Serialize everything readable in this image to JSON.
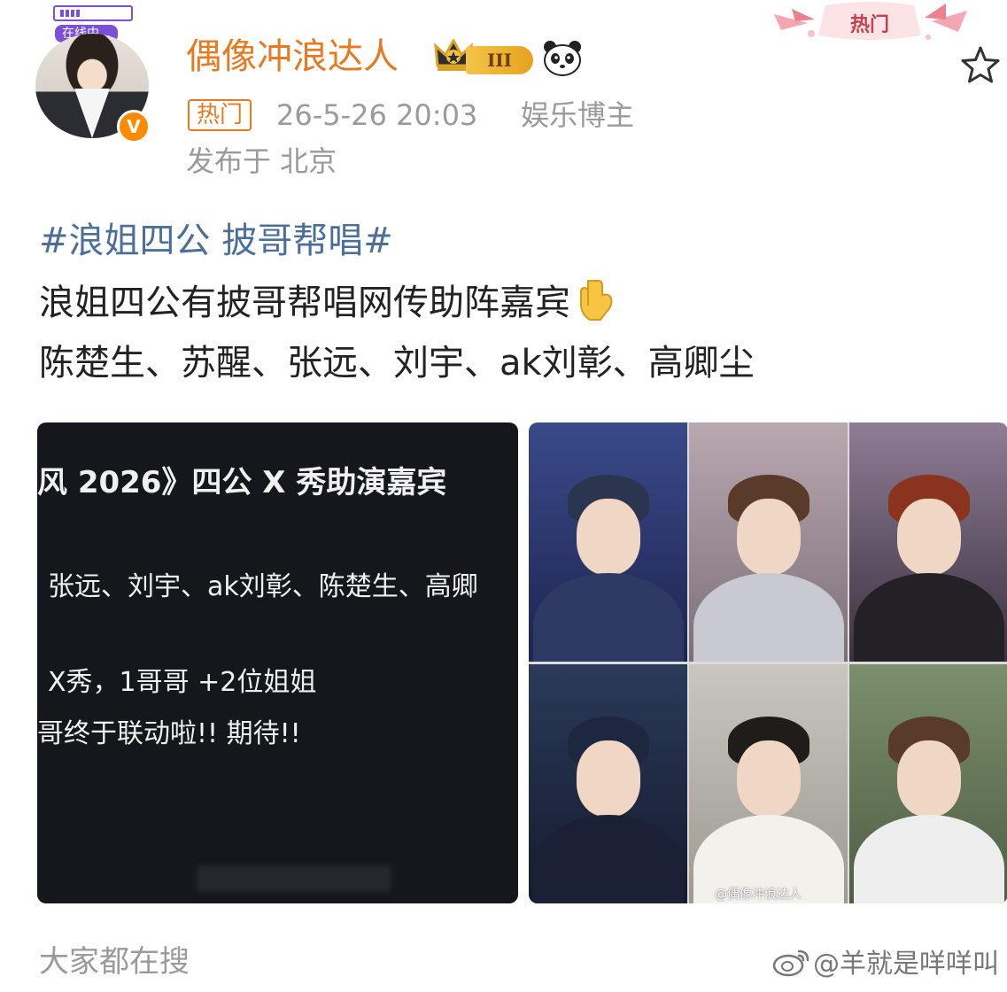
{
  "author": {
    "online_status": "在线中...",
    "name": "偶像冲浪达人",
    "level": "III",
    "verified_mark": "V",
    "icons": [
      "crown-icon",
      "panda-icon",
      "verified-icon"
    ]
  },
  "corner_badge": {
    "label": "热门"
  },
  "meta": {
    "tag": "热门",
    "time": "26-5-26 20:03",
    "role": "娱乐博主",
    "location": "发布于 北京"
  },
  "post": {
    "hashtag": "#浪姐四公 披哥帮唱#",
    "line1": "浪姐四公有披哥帮唱网传助阵嘉宾",
    "line2": "陈楚生、苏醒、张远、刘宇、ak刘彰、高卿尘"
  },
  "image_card": {
    "title": "风 2026》四公 X 秀助演嘉宾",
    "line2": "张远、刘宇、ak刘彰、陈楚生、高卿",
    "line3": "X秀，1哥哥 +2位姐姐",
    "line4": "哥终于联动啦!! 期待!!"
  },
  "collage": {
    "watermark": "@偶像冲浪达人"
  },
  "footer": {
    "search_label": "大家都在搜",
    "watermark": "@羊就是咩咩叫"
  },
  "colors": {
    "accent_orange": "#e8791f",
    "hashtag_blue": "#4c6f9a",
    "meta_gray": "#9a9a9a",
    "card_bg": "#16171c"
  }
}
